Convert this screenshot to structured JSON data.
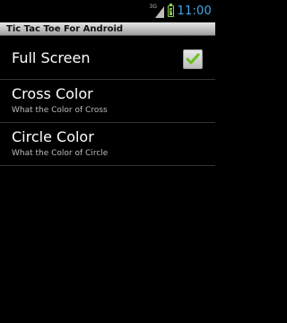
{
  "status_bar": {
    "network": "3G",
    "time": "11:00"
  },
  "title_bar": {
    "title": "Tic Tac Toe For Android"
  },
  "preferences": [
    {
      "title": "Full Screen",
      "summary": "",
      "checked": true
    },
    {
      "title": "Cross Color",
      "summary": "What the Color of Cross"
    },
    {
      "title": "Circle Color",
      "summary": "What the Color of Circle"
    }
  ],
  "colors": {
    "clock": "#3fa7e8",
    "battery": "#8fd14f",
    "check": "#6bbf1f"
  }
}
